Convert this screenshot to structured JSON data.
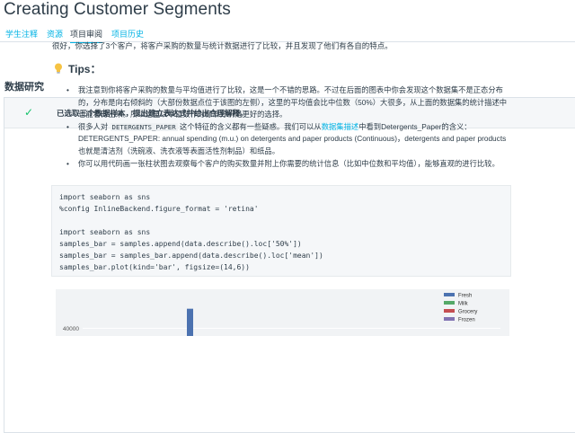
{
  "header": {
    "title": "Creating Customer Segments",
    "tabs": [
      {
        "label": "学生注释",
        "active": false
      },
      {
        "label": "资源",
        "active": false
      },
      {
        "label": "项目审阅",
        "active": true
      },
      {
        "label": "项目历史",
        "active": false
      }
    ]
  },
  "section": {
    "title": "数据研究"
  },
  "review": {
    "status_icon": "check-icon",
    "criterion": "已选取三个数据样本，提出建立表达式并给出合理解释。",
    "comment": "很好，你选择了3个客户，将客户采购的数量与统计数据进行了比较，并且发现了他们有各自的特点。",
    "tips_title": "Tips：",
    "tips": {
      "t1": "我注意到你将客户采购的数量与平均值进行了比较，这是一个不错的思路。不过在后面的图表中你会发现这个数据集不是正态分布的，分布是向右倾斜的（大部份数据点位于该图的左侧），这里的平均值会比中位数（50%）大很多，从上面的数据集的统计描述中也能看得出来。所以这里以中位数作为标准分析是更好的选择。",
      "t2_a": "很多人对",
      "t2_code": "DETERGENTS_PAPER",
      "t2_b": "这个特征的含义都有一些疑惑。我们可以从",
      "t2_link": "数据集描述",
      "t2_c": "中看到Detergents_Paper的含义：",
      "t2_d": "DETERGENTS_PAPER: annual spending (m.u.) on detergents and paper products (Continuous)",
      "t2_e": "，detergents and paper products 也就是清洁剂（洗碗液、洗衣液等表面活性剂制品）和纸品。",
      "t3": "你可以用代码画一张柱状图去观察每个客户的购买数量并附上你需要的统计信息（比如中位数和平均值），能够直观的进行比较。"
    },
    "code": [
      "import seaborn as sns",
      "%config InlineBackend.figure_format = 'retina'",
      "",
      "import seaborn as sns",
      "samples_bar = samples.append(data.describe().loc['50%'])",
      "samples_bar = samples_bar.append(data.describe().loc['mean'])",
      "samples_bar.plot(kind='bar', figsize=(14,6))"
    ]
  },
  "colors": {
    "accent": "#02b3e4",
    "check": "#15c26b",
    "fresh": "#4c72b0",
    "milk": "#55a868",
    "grocery": "#c44e52",
    "frozen": "#8172b2"
  },
  "chart_data": {
    "type": "bar",
    "ytick_labels": [
      "40000"
    ],
    "legend": [
      "Fresh",
      "Milk",
      "Grocery",
      "Frozen"
    ],
    "legend_position": "top-right",
    "visible_bars": [
      {
        "series": "Fresh",
        "value": 45000
      }
    ],
    "ylim_visible": [
      38000,
      50000
    ]
  }
}
